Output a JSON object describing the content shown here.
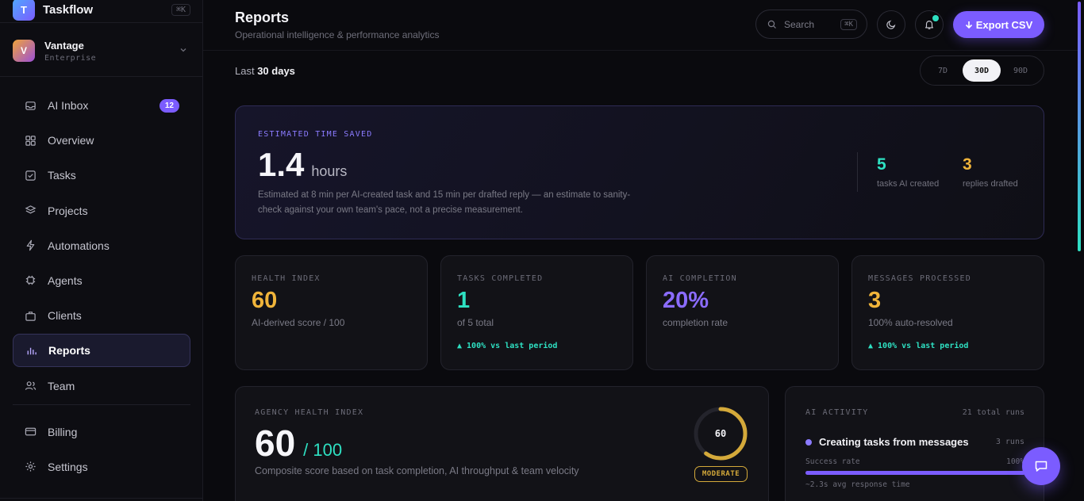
{
  "brand": {
    "name": "Taskflow",
    "logo_letter": "T",
    "shortcut": "⌘K"
  },
  "workspace": {
    "avatar": "V",
    "name": "Vantage",
    "plan": "Enterprise"
  },
  "sidebar": {
    "items": [
      {
        "label": "AI Inbox",
        "icon": "inbox-icon",
        "badge": "12"
      },
      {
        "label": "Overview",
        "icon": "grid-icon"
      },
      {
        "label": "Tasks",
        "icon": "checkbox-icon"
      },
      {
        "label": "Projects",
        "icon": "layers-icon"
      },
      {
        "label": "Automations",
        "icon": "bolt-icon"
      },
      {
        "label": "Agents",
        "icon": "chip-icon"
      },
      {
        "label": "Clients",
        "icon": "briefcase-icon"
      },
      {
        "label": "Reports",
        "icon": "bar-chart-icon",
        "active": true
      },
      {
        "label": "Team",
        "icon": "users-icon"
      }
    ],
    "bottom_items": [
      {
        "label": "Billing",
        "icon": "credit-card-icon"
      },
      {
        "label": "Settings",
        "icon": "gear-icon"
      }
    ]
  },
  "header": {
    "title": "Reports",
    "subtitle": "Operational intelligence & performance analytics",
    "search_placeholder": "Search",
    "search_shortcut": "⌘K",
    "export_label": "Export CSV"
  },
  "range": {
    "prefix": "Last",
    "value": "30 days",
    "options": [
      "7D",
      "30D",
      "90D"
    ],
    "selected": "30D"
  },
  "hero": {
    "eyebrow": "ESTIMATED TIME SAVED",
    "value": "1.4",
    "unit": "hours",
    "description": "Estimated at 8 min per AI-created task and 15 min per drafted reply — an estimate to sanity-check against your own team's pace, not a precise measurement.",
    "stats": [
      {
        "value": "5",
        "label": "tasks AI created",
        "color": "#2ee0c2"
      },
      {
        "value": "3",
        "label": "replies drafted",
        "color": "#f0b43a"
      }
    ]
  },
  "kpis": [
    {
      "eyebrow": "HEALTH INDEX",
      "value": "60",
      "sub": "AI-derived score / 100",
      "trend": "",
      "color": "#f0b43a"
    },
    {
      "eyebrow": "TASKS COMPLETED",
      "value": "1",
      "sub": "of 5 total",
      "trend": "▲ 100% vs last period",
      "color": "#2ee0c2"
    },
    {
      "eyebrow": "AI COMPLETION",
      "value": "20%",
      "sub": "completion rate",
      "trend": "",
      "color": "#8b6cff"
    },
    {
      "eyebrow": "MESSAGES PROCESSED",
      "value": "3",
      "sub": "100% auto-resolved",
      "trend": "▲ 100% vs last period",
      "color": "#f0b43a"
    }
  ],
  "agency": {
    "eyebrow": "AGENCY HEALTH INDEX",
    "value": "60",
    "denominator": "/ 100",
    "description": "Composite score based on task completion, AI throughput & team velocity",
    "gauge_value": "60",
    "gauge_fraction": 0.6,
    "status": "MODERATE",
    "gauge_color": "#d4a93a"
  },
  "ai_activity": {
    "eyebrow": "AI ACTIVITY",
    "total": "21 total runs",
    "row": {
      "title": "Creating tasks from messages",
      "runs": "3 runs",
      "success_label": "Success rate",
      "success_value": "100%",
      "success_fraction": 1.0,
      "response": "~2.3s avg response time"
    }
  }
}
